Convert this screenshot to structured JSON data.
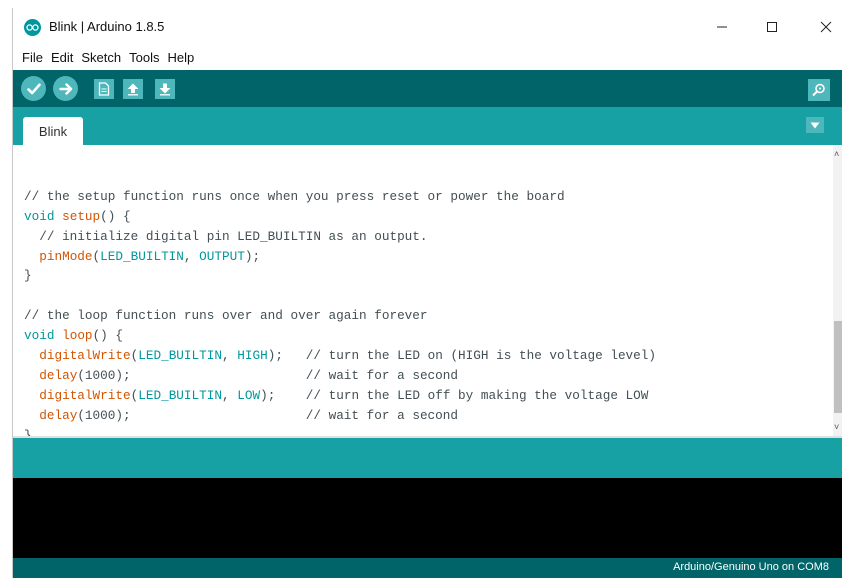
{
  "window": {
    "title": "Blink | Arduino 1.8.5",
    "controls": {
      "minimize": "—",
      "maximize": "☐",
      "close": "✕"
    }
  },
  "menu": [
    "File",
    "Edit",
    "Sketch",
    "Tools",
    "Help"
  ],
  "toolbar": {
    "buttons": [
      "verify-icon",
      "upload-icon",
      "new-icon",
      "open-icon",
      "save-icon"
    ],
    "right_button": "serial-monitor-icon"
  },
  "tabs": [
    {
      "label": "Blink",
      "active": true
    }
  ],
  "editor": {
    "lines": [
      [],
      [
        {
          "t": "// the setup function runs once when you press reset or power the board",
          "c": "cm"
        }
      ],
      [
        {
          "t": "void",
          "c": "kw"
        },
        {
          "t": " ",
          "c": "tx"
        },
        {
          "t": "setup",
          "c": "fn"
        },
        {
          "t": "() {",
          "c": "tx"
        }
      ],
      [
        {
          "t": "  // initialize digital pin LED_BUILTIN as an output.",
          "c": "cm"
        }
      ],
      [
        {
          "t": "  ",
          "c": "tx"
        },
        {
          "t": "pinMode",
          "c": "fn"
        },
        {
          "t": "(",
          "c": "tx"
        },
        {
          "t": "LED_BUILTIN",
          "c": "ct"
        },
        {
          "t": ", ",
          "c": "tx"
        },
        {
          "t": "OUTPUT",
          "c": "ct"
        },
        {
          "t": ");",
          "c": "tx"
        }
      ],
      [
        {
          "t": "}",
          "c": "tx"
        }
      ],
      [],
      [
        {
          "t": "// the loop function runs over and over again forever",
          "c": "cm"
        }
      ],
      [
        {
          "t": "void",
          "c": "kw"
        },
        {
          "t": " ",
          "c": "tx"
        },
        {
          "t": "loop",
          "c": "fn"
        },
        {
          "t": "() {",
          "c": "tx"
        }
      ],
      [
        {
          "t": "  ",
          "c": "tx"
        },
        {
          "t": "digitalWrite",
          "c": "fn"
        },
        {
          "t": "(",
          "c": "tx"
        },
        {
          "t": "LED_BUILTIN",
          "c": "ct"
        },
        {
          "t": ", ",
          "c": "tx"
        },
        {
          "t": "HIGH",
          "c": "ct"
        },
        {
          "t": ");   ",
          "c": "tx"
        },
        {
          "t": "// turn the LED on (HIGH is the voltage level)",
          "c": "cm"
        }
      ],
      [
        {
          "t": "  ",
          "c": "tx"
        },
        {
          "t": "delay",
          "c": "fn"
        },
        {
          "t": "(1000);                       ",
          "c": "tx"
        },
        {
          "t": "// wait for a second",
          "c": "cm"
        }
      ],
      [
        {
          "t": "  ",
          "c": "tx"
        },
        {
          "t": "digitalWrite",
          "c": "fn"
        },
        {
          "t": "(",
          "c": "tx"
        },
        {
          "t": "LED_BUILTIN",
          "c": "ct"
        },
        {
          "t": ", ",
          "c": "tx"
        },
        {
          "t": "LOW",
          "c": "ct"
        },
        {
          "t": ");    ",
          "c": "tx"
        },
        {
          "t": "// turn the LED off by making the voltage LOW",
          "c": "cm"
        }
      ],
      [
        {
          "t": "  ",
          "c": "tx"
        },
        {
          "t": "delay",
          "c": "fn"
        },
        {
          "t": "(1000);                       ",
          "c": "tx"
        },
        {
          "t": "// wait for a second",
          "c": "cm"
        }
      ],
      [
        {
          "t": "}",
          "c": "tx"
        }
      ]
    ]
  },
  "status": {
    "board": "Arduino/Genuino Uno on COM8"
  },
  "colors": {
    "toolbar_dark": "#006468",
    "tab_bar": "#17a1a5",
    "button_light": "#4db7bb",
    "keyword": "#00979c",
    "function": "#d35400",
    "comment": "#434f54"
  }
}
